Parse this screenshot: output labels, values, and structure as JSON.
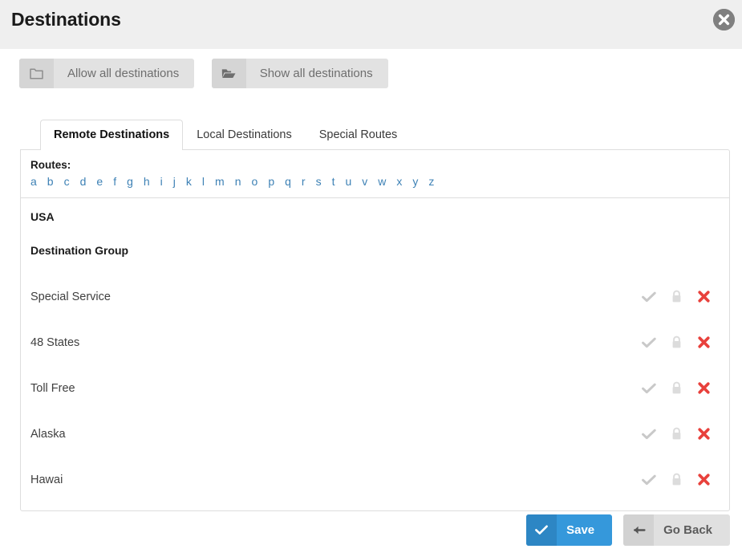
{
  "header": {
    "title": "Destinations",
    "close_icon": "close-circle-icon"
  },
  "top_actions": [
    {
      "label": "Allow all destinations",
      "icon": "folder-outline-icon"
    },
    {
      "label": "Show all destinations",
      "icon": "folder-open-icon"
    }
  ],
  "tabs": [
    {
      "label": "Remote Destinations",
      "active": true
    },
    {
      "label": "Local Destinations",
      "active": false
    },
    {
      "label": "Special Routes",
      "active": false
    }
  ],
  "routes": {
    "label": "Routes:",
    "letters": [
      "a",
      "b",
      "c",
      "d",
      "e",
      "f",
      "g",
      "h",
      "i",
      "j",
      "k",
      "l",
      "m",
      "n",
      "o",
      "p",
      "q",
      "r",
      "s",
      "t",
      "u",
      "v",
      "w",
      "x",
      "y",
      "z"
    ]
  },
  "list": {
    "country": "USA",
    "group_title": "Destination Group",
    "row_icons": {
      "allow": "check-icon",
      "lock": "lock-icon",
      "remove": "red-x-icon"
    },
    "rows": [
      {
        "name": "Special Service"
      },
      {
        "name": "48 States"
      },
      {
        "name": "Toll Free"
      },
      {
        "name": "Alaska"
      },
      {
        "name": "Hawai"
      }
    ]
  },
  "footer": {
    "save_label": "Save",
    "save_icon": "check-icon",
    "back_label": "Go Back",
    "back_icon": "arrow-left-icon"
  },
  "colors": {
    "accent_blue": "#3598db",
    "link_blue": "#3d81b5",
    "danger_red": "#e8413c",
    "header_bg": "#efefef",
    "muted_gray": "#c9c9c9"
  }
}
